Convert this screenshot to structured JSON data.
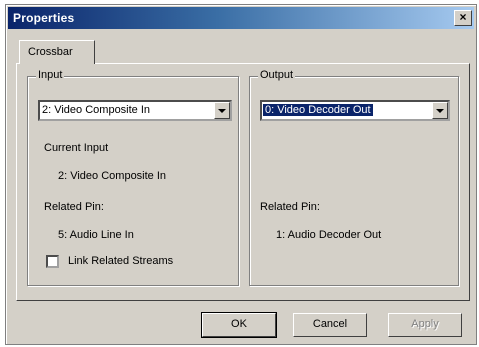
{
  "window": {
    "title": "Properties",
    "close_label": "×"
  },
  "tabs": [
    {
      "label": "Crossbar"
    }
  ],
  "input": {
    "group_label": "Input",
    "selected": "2: Video Composite In",
    "current_input_label": "Current Input",
    "current_input_value": "2: Video Composite In",
    "related_pin_label": "Related Pin:",
    "related_pin_value": "5: Audio Line In",
    "link_label": "Link Related Streams"
  },
  "output": {
    "group_label": "Output",
    "selected": "0: Video Decoder Out",
    "related_pin_label": "Related Pin:",
    "related_pin_value": "1: Audio Decoder Out"
  },
  "buttons": {
    "ok": "OK",
    "cancel": "Cancel",
    "apply": "Apply"
  }
}
